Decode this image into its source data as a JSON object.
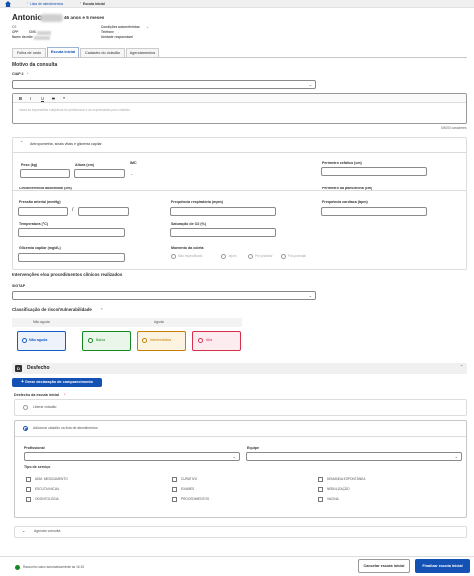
{
  "breadcrumb": {
    "home_icon": "home-icon",
    "items": [
      "Lista de atendimentos",
      "Escuta inicial"
    ]
  },
  "patient": {
    "name": "Antonio",
    "age": "46 anos e 5 meses",
    "cs_label": "CS",
    "cpf_label": "CPF",
    "cns_label": "CNS",
    "mother_label": "Nome da mãe",
    "conditions": "Condições autorreferidas",
    "phone": "Telefone",
    "unit": "Unidade responsável"
  },
  "tabs": [
    "Folha de rosto",
    "Escuta inicial",
    "Cadastro do cidadão",
    "Agendamentos"
  ],
  "motivo": {
    "title": "Motivo da consulta",
    "ciap_label": "CIAP 2",
    "editor_placeholder": "Insira as impressões subjetivas do profissional e as expressadas pelo cidadão.",
    "counter": "0/4000 caracteres",
    "toolbar": [
      "B",
      "I",
      "U",
      "S",
      "❝"
    ]
  },
  "antropo": {
    "title": "Antropometria, sinais vitais e glicemia capilar",
    "peso": "Peso (kg)",
    "altura": "Altura (cm)",
    "imc": "IMC",
    "imc_value": "-",
    "perimetro_cefalico": "Perímetro cefálico (cm)",
    "circ_abdominal": "Circunferência abdominal (cm)",
    "perimetro_panturrilha": "Perímetro da panturrilha (cm)",
    "pressao": "Pressão arterial (mmHg)",
    "pressao_sep": "/",
    "freq_resp": "Frequência respiratória (mpm)",
    "freq_card": "Frequência cardíaca (bpm)",
    "temp": "Temperatura (°C)",
    "sat": "Saturação de O2 (%)",
    "glicemia": "Glicemia capilar (mg/dL)",
    "momento": "Momento da coleta",
    "momentos": [
      "Não especificado",
      "Jejum",
      "Pré-prandial",
      "Pós-prandial"
    ]
  },
  "intervencoes": {
    "title": "Intervenções e/ou procedimentos clínicos realizados",
    "sigtap_label": "SIGTAP"
  },
  "risco": {
    "title": "Classificação de risco/Vulnerabilidade",
    "group_nao": "Não aguda",
    "group_aguda": "Aguda",
    "options": [
      "Não aguda",
      "Baixa",
      "Intermediária",
      "Alta"
    ]
  },
  "desfecho": {
    "title": "Desfecho",
    "icon_label": "D",
    "add_button": "Gerar declaração de comparecimento",
    "escuta_label": "Desfecho da escuta inicial",
    "liberar": "Liberar cidadão",
    "adicionar": "Adicionar cidadão na lista de atendimentos",
    "profissional": "Profissional",
    "equipe": "Equipe",
    "servico_label": "Tipo de serviço",
    "servicos": [
      "ADM. MEDICAMENTO",
      "CURATIVO",
      "DEMANDA ESPONTÂNEA",
      "ESCUTA INICIAL",
      "EXAMES",
      "NEBULIZAÇÃO",
      "ODONTOLOGIA",
      "PROCEDIMENTOS",
      "VACINA"
    ],
    "agendar": "Agendar consulta"
  },
  "footer": {
    "saved": "Rascunho salvo automaticamente às 16:15",
    "cancel": "Cancelar escuta inicial",
    "finish": "Finalizar escuta inicial"
  },
  "colors": {
    "primary": "#1351b4",
    "nao_aguda": "#155bcb",
    "baixa": "#168821",
    "intermediaria": "#c77e00",
    "alta": "#d6304d"
  }
}
